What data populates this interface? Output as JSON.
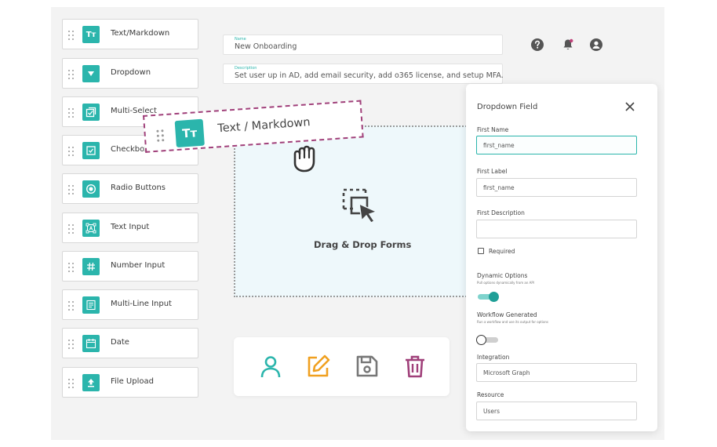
{
  "palette": {
    "items": [
      {
        "label": "Text/Markdown",
        "icon": "text-format-icon"
      },
      {
        "label": "Dropdown",
        "icon": "dropdown-arrow-icon"
      },
      {
        "label": "Multi-Select",
        "icon": "multi-checkbox-icon"
      },
      {
        "label": "Checkbox",
        "icon": "checkbox-icon"
      },
      {
        "label": "Radio Buttons",
        "icon": "radio-icon"
      },
      {
        "label": "Text Input",
        "icon": "text-input-icon"
      },
      {
        "label": "Number Input",
        "icon": "hash-icon"
      },
      {
        "label": "Multi-Line Input",
        "icon": "lines-icon"
      },
      {
        "label": "Date",
        "icon": "calendar-icon"
      },
      {
        "label": "File Upload",
        "icon": "upload-icon"
      }
    ]
  },
  "form": {
    "name_label": "Name",
    "name_value": "New Onboarding",
    "description_label": "Description",
    "description_value": "Set user up in AD, add email security, add o365 license, and setup MFA."
  },
  "dragging": {
    "label": "Text / Markdown",
    "icon_text": "Tт"
  },
  "dropzone": {
    "label": "Drag & Drop Forms"
  },
  "panel": {
    "title": "Dropdown Field",
    "first_name_label": "First Name",
    "first_name_value": "first_name",
    "first_label_label": "First Label",
    "first_label_value": "first_name",
    "first_description_label": "First Description",
    "first_description_value": "",
    "required_label": "Required",
    "dynamic_options_label": "Dynamic Options",
    "dynamic_options_sub": "Pull options dynamically from an API",
    "dynamic_options_on": true,
    "workflow_generated_label": "Workflow Generated",
    "workflow_generated_sub": "Run a workflow and use its output for options",
    "workflow_generated_on": false,
    "integration_label": "Integration",
    "integration_value": "Microsoft Graph",
    "resource_label": "Resource",
    "resource_value": "Users"
  },
  "colors": {
    "accent": "#2bb5ac",
    "edit": "#f0a020",
    "delete": "#a0407a",
    "save": "#777777"
  }
}
